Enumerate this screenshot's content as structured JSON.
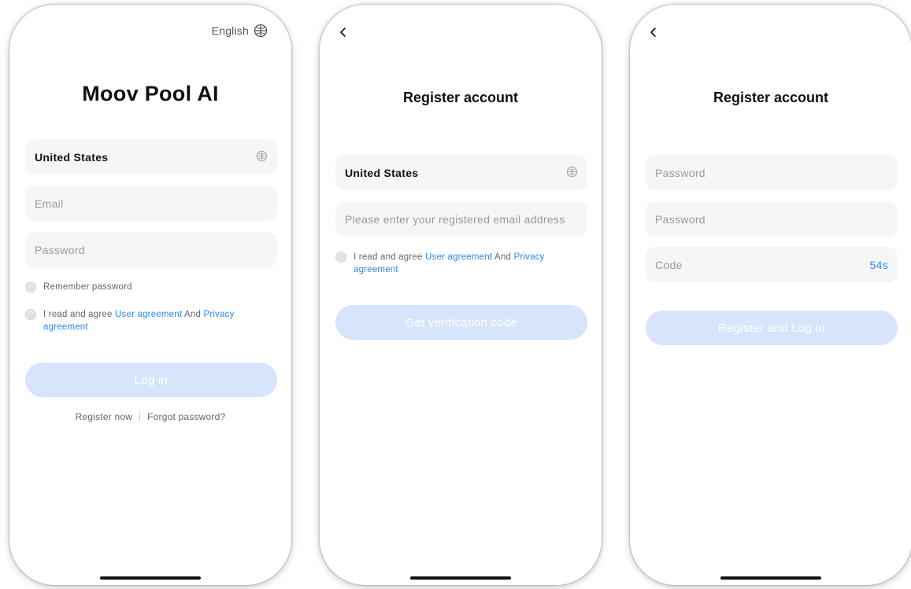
{
  "login": {
    "language_label": "English",
    "app_title": "Moov Pool AI",
    "country_value": "United States",
    "email_placeholder": "Email",
    "password_placeholder": "Password",
    "remember_label": "Remember password",
    "agree_prefix": "I read and agree ",
    "user_agreement_link": "User agreement",
    "agree_and": " And ",
    "privacy_link": "Privacy agreement",
    "login_button": "Log in",
    "register_link": "Register now",
    "forgot_link": "Forgot password?"
  },
  "register_email": {
    "title": "Register account",
    "country_value": "United States",
    "email_placeholder": "Please enter your registered email address",
    "agree_prefix": "I read and agree ",
    "user_agreement_link": "User agreement",
    "agree_and": " And ",
    "privacy_link": "Privacy agreement",
    "submit_button": "Get verification code"
  },
  "register_password": {
    "title": "Register account",
    "password_placeholder": "Password",
    "confirm_password_placeholder": "Password",
    "code_placeholder": "Code",
    "countdown": "54s",
    "submit_button": "Register and Log in"
  },
  "icons": {
    "globe": "globe-icon",
    "back": "chevron-left-icon"
  },
  "colors": {
    "accent": "#2f86f0",
    "button_disabled": "#d6e5fc",
    "field_bg": "#f6f6f7"
  }
}
